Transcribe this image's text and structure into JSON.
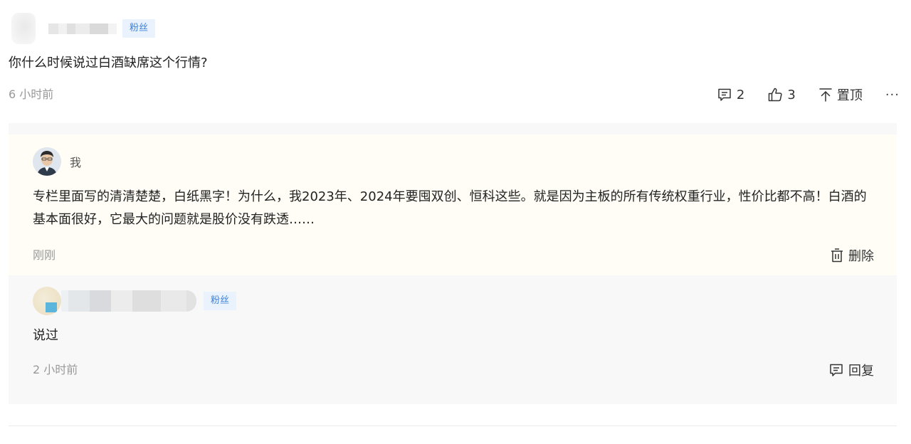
{
  "comment": {
    "fan_badge": "粉丝",
    "text": "你什么时候说过白酒缺席这个行情?",
    "time": "6 小时前",
    "reply_count": "2",
    "like_count": "3",
    "pin_label": "置顶",
    "more_label": "···"
  },
  "replies": [
    {
      "author": "我",
      "text": "专栏里面写的清清楚楚，白纸黑字！为什么，我2023年、2024年要囤双创、恒科这些。就是因为主板的所有传统权重行业，性价比都不高！白酒的基本面很好，它最大的问题就是股价没有跌透……",
      "time": "刚刚",
      "action_label": "删除"
    },
    {
      "fan_badge": "粉丝",
      "text": "说过",
      "time": "2 小时前",
      "action_label": "回复"
    }
  ],
  "colors": {
    "badge_bg": "#eaf3fd",
    "badge_text": "#3d7fd6",
    "self_reply_bg": "#fffdf6",
    "reply_bg": "#f8f8f8",
    "muted_text": "#999999"
  }
}
